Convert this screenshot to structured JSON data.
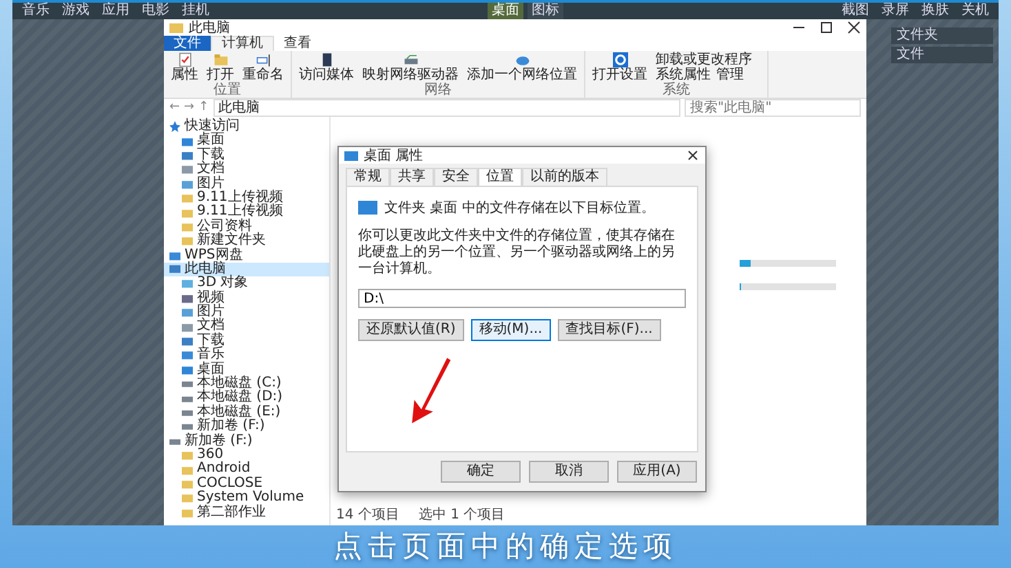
{
  "recorder_toolbar": {
    "left_items": [
      "音乐",
      "游戏",
      "应用",
      "电影",
      "挂机"
    ],
    "center_tabs": [
      {
        "label": "桌面",
        "selected": true
      },
      {
        "label": "图标",
        "selected": false
      }
    ],
    "right_items": [
      "截图",
      "录屏",
      "换肤",
      "关机"
    ]
  },
  "side_panel": {
    "items": [
      "文件夹",
      "文件"
    ]
  },
  "explorer": {
    "title": "此电脑",
    "ribbon_tabs": [
      {
        "label": "文件",
        "kind": "file",
        "selected": false
      },
      {
        "label": "计算机",
        "kind": "tab",
        "selected": true
      },
      {
        "label": "查看",
        "kind": "tab",
        "selected": false
      }
    ],
    "ribbon_groups": [
      {
        "label": "位置",
        "commands": [
          {
            "label": "属性",
            "kind": "check"
          },
          {
            "label": "打开",
            "kind": "folder"
          },
          {
            "label": "重命名",
            "kind": "rename"
          }
        ]
      },
      {
        "label": "网络",
        "commands": [
          {
            "label": "访问媒体",
            "kind": "media"
          },
          {
            "label": "映射网络驱动器",
            "kind": "drive"
          },
          {
            "label": "添加一个网络位置",
            "kind": "cloud"
          }
        ]
      },
      {
        "label": "系统",
        "commands": [
          {
            "label": "打开设置",
            "kind": "gear"
          }
        ],
        "small_commands": [
          "卸载或更改程序",
          "系统属性",
          "管理"
        ]
      }
    ],
    "address": {
      "nav_buttons": [
        "←",
        "→",
        "↑"
      ],
      "path": "此电脑",
      "search_placeholder": "搜索\"此电脑\""
    },
    "nav": [
      {
        "label": "快速访问",
        "kind": "star",
        "selected": false,
        "children": [
          {
            "label": "桌面",
            "kind": "desktop",
            "selected": false
          },
          {
            "label": "下载",
            "kind": "download",
            "selected": false
          },
          {
            "label": "文档",
            "kind": "doc",
            "selected": false
          },
          {
            "label": "图片",
            "kind": "picture",
            "selected": false
          },
          {
            "label": "9.11上传视频",
            "kind": "folder",
            "selected": false
          },
          {
            "label": "9.11上传视频",
            "kind": "folder",
            "selected": false
          },
          {
            "label": "公司资料",
            "kind": "folder",
            "selected": false
          },
          {
            "label": "新建文件夹",
            "kind": "folder",
            "selected": false
          }
        ]
      },
      {
        "label": "WPS网盘",
        "kind": "cloud",
        "selected": false
      },
      {
        "label": "此电脑",
        "kind": "pc",
        "selected": true,
        "children": [
          {
            "label": "3D 对象",
            "kind": "cube",
            "selected": false
          },
          {
            "label": "视频",
            "kind": "video",
            "selected": false
          },
          {
            "label": "图片",
            "kind": "picture",
            "selected": false
          },
          {
            "label": "文档",
            "kind": "doc",
            "selected": false
          },
          {
            "label": "下载",
            "kind": "download",
            "selected": false
          },
          {
            "label": "音乐",
            "kind": "music",
            "selected": false
          },
          {
            "label": "桌面",
            "kind": "desktop",
            "selected": false
          },
          {
            "label": "本地磁盘 (C:)",
            "kind": "drive",
            "selected": false
          },
          {
            "label": "本地磁盘 (D:)",
            "kind": "drive",
            "selected": false
          },
          {
            "label": "本地磁盘 (E:)",
            "kind": "drive",
            "selected": false
          },
          {
            "label": "新加卷 (F:)",
            "kind": "drive",
            "selected": false
          }
        ]
      },
      {
        "label": "新加卷 (F:)",
        "kind": "drive",
        "selected": false,
        "children": [
          {
            "label": "360",
            "kind": "folder",
            "selected": false
          },
          {
            "label": "Android",
            "kind": "folder",
            "selected": false
          },
          {
            "label": "COCLOSE",
            "kind": "folder",
            "selected": false
          },
          {
            "label": "System Volume",
            "kind": "folder",
            "selected": false
          },
          {
            "label": "第二部作业",
            "kind": "folder",
            "selected": false
          }
        ]
      }
    ],
    "drives": [
      {
        "level": 0.12
      },
      {
        "level": 0.02
      }
    ],
    "status_bar": [
      "14 个项目",
      "选中 1 个项目"
    ]
  },
  "dialog": {
    "title": "桌面 属性",
    "tabs": [
      {
        "label": "常规",
        "selected": false
      },
      {
        "label": "共享",
        "selected": false
      },
      {
        "label": "安全",
        "selected": false
      },
      {
        "label": "位置",
        "selected": true
      },
      {
        "label": "以前的版本",
        "selected": false
      }
    ],
    "info": "文件夹 桌面 中的文件存储在以下目标位置。",
    "description": "你可以更改此文件夹中文件的存储位置，使其存储在此硬盘上的另一个位置、另一个驱动器或网络上的另一台计算机。",
    "path_value": "D:\\",
    "buttons": [
      {
        "label": "还原默认值(R)",
        "focused": false
      },
      {
        "label": "移动(M)...",
        "focused": true
      },
      {
        "label": "查找目标(F)...",
        "focused": false
      }
    ],
    "footer_buttons": [
      {
        "label": "确定",
        "focused": false
      },
      {
        "label": "取消",
        "focused": false
      },
      {
        "label": "应用(A)",
        "focused": false
      }
    ]
  },
  "caption": "点击页面中的确定选项"
}
